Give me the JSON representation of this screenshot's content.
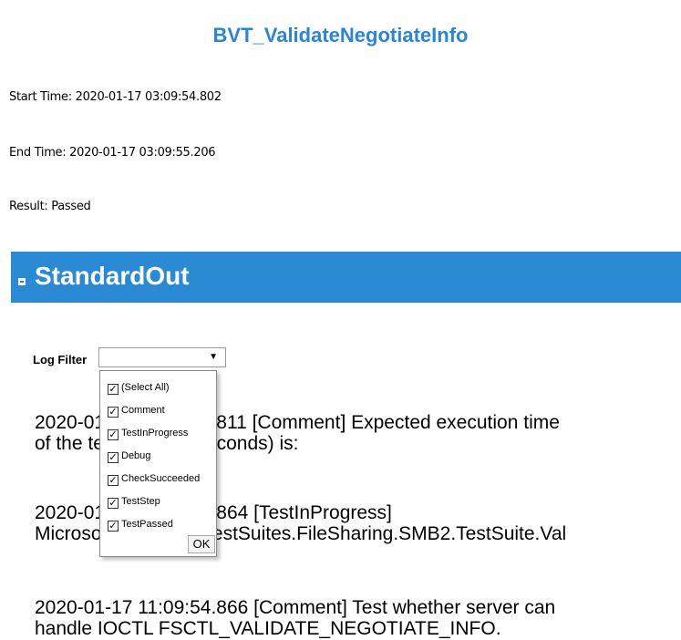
{
  "title": "BVT_ValidateNegotiateInfo",
  "meta": {
    "start_time": "Start Time: 2020-01-17 03:09:54.802",
    "end_time": "End Time: 2020-01-17 03:09:55.206",
    "result": "Result: Passed"
  },
  "section": {
    "title": "StandardOut"
  },
  "log_filter": {
    "label": "Log Filter",
    "selected_value": "",
    "dropdown_arrow": "▼",
    "options": [
      {
        "label": "(Select All)",
        "checked": true
      },
      {
        "label": "Comment",
        "checked": true
      },
      {
        "label": "TestInProgress",
        "checked": true
      },
      {
        "label": "Debug",
        "checked": true
      },
      {
        "label": "CheckSucceeded",
        "checked": true
      },
      {
        "label": "TestStep",
        "checked": true
      },
      {
        "label": "TestPassed",
        "checked": true
      }
    ],
    "ok_label": "OK"
  },
  "log_entries": [
    {
      "lines": [
        "2020-01-17 11:09:54.811 [Comment] Expected execution time",
        "of the test case (in seconds) is:"
      ]
    },
    {
      "lines": [
        "2020-01-17 11:09:54.864 [TestInProgress]",
        "Microsoft.Protocols.TestSuites.FileSharing.SMB2.TestSuite.Val"
      ]
    },
    {
      "lines": [
        "2020-01-17 11:09:54.866 [Comment] Test whether server can",
        "handle IOCTL FSCTL_VALIDATE_NEGOTIATE_INFO."
      ]
    }
  ],
  "colors": {
    "title": "#2a85d6",
    "banner": "#2a8ad4"
  }
}
